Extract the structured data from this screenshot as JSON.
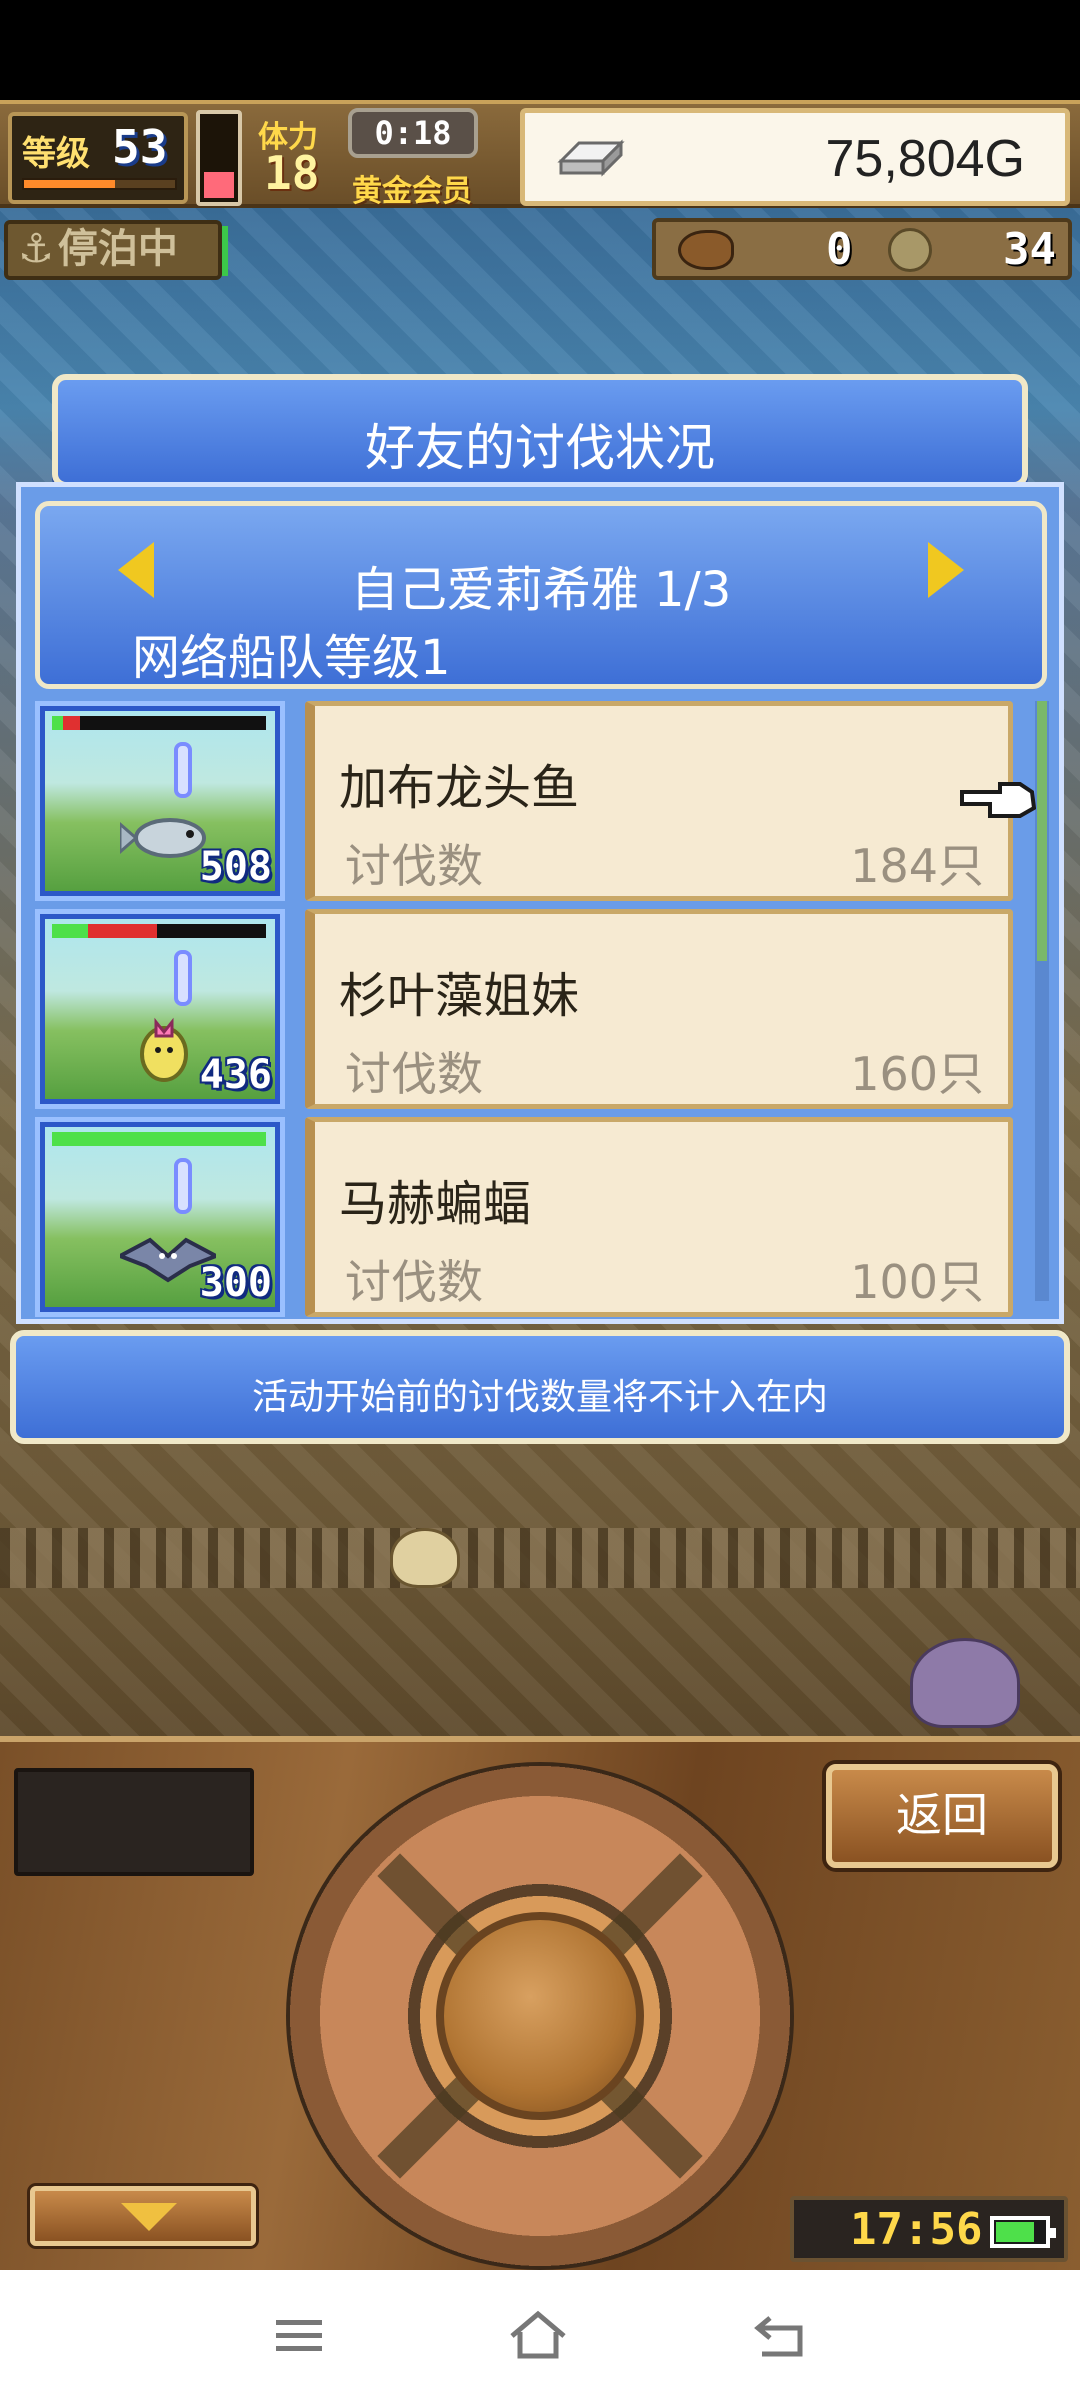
{
  "hud": {
    "level_label": "等级",
    "level": "53",
    "level_xp_fraction": 0.6,
    "stamina_fraction": 0.3,
    "stamina_label": "体力",
    "stamina": "18",
    "timer": "0:18",
    "member_label": "黄金会员",
    "money": "75,804G",
    "anchor_status": "停泊中",
    "item_count_1": "0",
    "item_count_2": "34"
  },
  "dialog": {
    "title": "好友的讨伐状况",
    "player_name": "自己爱莉希雅 1/3",
    "fleet_level": "网络船队等级1",
    "kill_label": "讨伐数",
    "monsters": [
      {
        "name": "加布龙头鱼",
        "kills": "184只",
        "level_badge": "508",
        "hp_green": 0.05,
        "hp_red": 0.08
      },
      {
        "name": "杉叶藻姐妹",
        "kills": "160只",
        "level_badge": "436",
        "hp_green": 0.17,
        "hp_red": 0.32
      },
      {
        "name": "马赫蝙蝠",
        "kills": "100只",
        "level_badge": "300",
        "hp_green": 1.0,
        "hp_red": 0.0
      }
    ],
    "note": "活动开始前的讨伐数量将不计入在内"
  },
  "controls": {
    "back_label": "返回",
    "clock": "17:56",
    "battery_fraction": 0.8
  },
  "colors": {
    "dialog_blue": "#3e6fd6",
    "card_cream": "#f6ead2",
    "gold_arrow": "#f0c820",
    "hp_green": "#4ee04a",
    "hp_red": "#e03030"
  }
}
